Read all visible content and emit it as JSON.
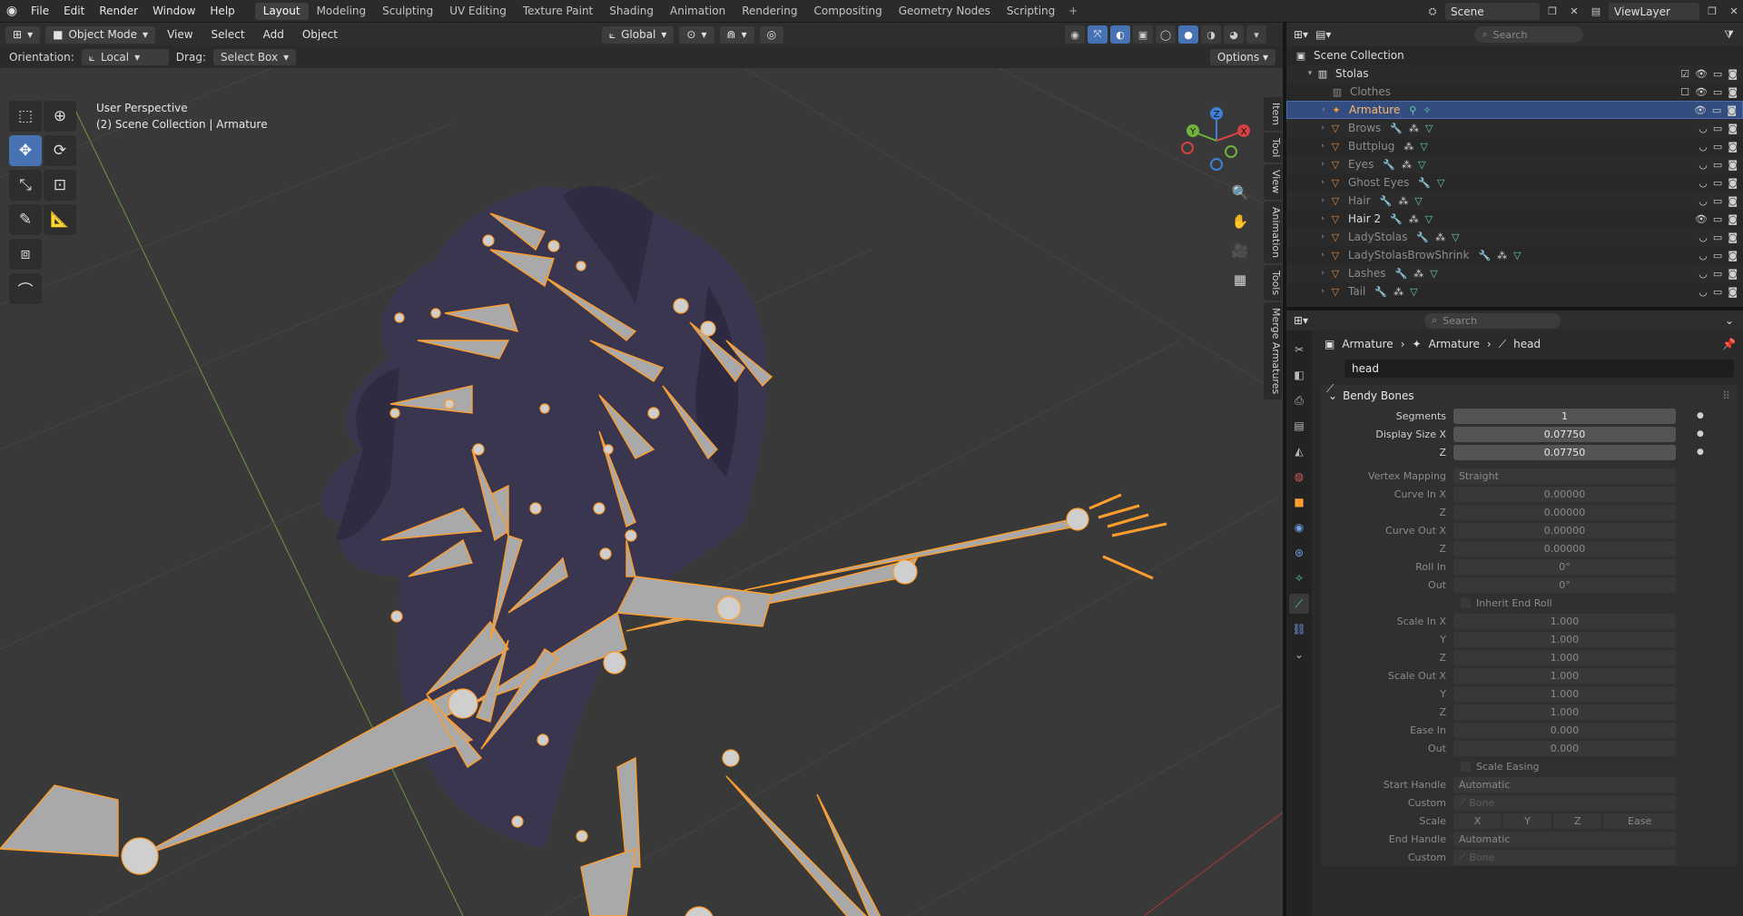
{
  "topbar": {
    "menu": [
      "File",
      "Edit",
      "Render",
      "Window",
      "Help"
    ],
    "workspaces": [
      "Layout",
      "Modeling",
      "Sculpting",
      "UV Editing",
      "Texture Paint",
      "Shading",
      "Animation",
      "Rendering",
      "Compositing",
      "Geometry Nodes",
      "Scripting"
    ],
    "active_workspace": "Layout",
    "scene_name": "Scene",
    "view_layer": "ViewLayer"
  },
  "viewport": {
    "mode": "Object Mode",
    "menu": [
      "View",
      "Select",
      "Add",
      "Object"
    ],
    "transform_orientation": "Global",
    "orientation_label": "Orientation:",
    "orientation_value": "Local",
    "drag_label": "Drag:",
    "drag_value": "Select Box",
    "options_label": "Options",
    "perspective": "User Perspective",
    "collection_info": "(2) Scene Collection | Armature",
    "side_tabs": [
      "Item",
      "Tool",
      "View",
      "Animation",
      "Tools",
      "Merge Armatures"
    ],
    "gizmo_labels": {
      "x": "X",
      "y": "Y",
      "z": "Z"
    }
  },
  "outliner": {
    "search_placeholder": "Search",
    "root": "Scene Collection",
    "collection": "Stolas",
    "items": [
      {
        "name": "Clothes",
        "dim": true
      },
      {
        "name": "Armature",
        "selected": true
      },
      {
        "name": "Brows"
      },
      {
        "name": "Buttplug"
      },
      {
        "name": "Eyes"
      },
      {
        "name": "Ghost Eyes"
      },
      {
        "name": "Hair"
      },
      {
        "name": "Hair 2",
        "bright": true
      },
      {
        "name": "LadyStolas"
      },
      {
        "name": "LadyStolasBrowShrink"
      },
      {
        "name": "Lashes"
      },
      {
        "name": "Tail"
      }
    ]
  },
  "properties": {
    "search_placeholder": "Search",
    "breadcrumb": [
      "Armature",
      "Armature",
      "head"
    ],
    "bone_name": "head",
    "panel_title": "Bendy Bones",
    "segments_label": "Segments",
    "segments": "1",
    "display_size_x_label": "Display Size X",
    "display_size_x": "0.07750",
    "z_label": "Z",
    "display_size_z": "0.07750",
    "vertex_mapping_label": "Vertex Mapping",
    "vertex_mapping": "Straight",
    "curve_in_x_label": "Curve In X",
    "curve_in_x": "0.00000",
    "curve_in_z": "0.00000",
    "curve_out_x_label": "Curve Out X",
    "curve_out_x": "0.00000",
    "curve_out_z": "0.00000",
    "roll_in_label": "Roll In",
    "roll_in": "0°",
    "out_label": "Out",
    "roll_out": "0°",
    "inherit_end_roll": "Inherit End Roll",
    "scale_in_x_label": "Scale In X",
    "scale_in_x": "1.000",
    "y_label": "Y",
    "scale_in_y": "1.000",
    "scale_in_z": "1.000",
    "scale_out_x_label": "Scale Out X",
    "scale_out_x": "1.000",
    "scale_out_y": "1.000",
    "scale_out_z": "1.000",
    "ease_in_label": "Ease In",
    "ease_in": "0.000",
    "ease_out": "0.000",
    "scale_easing": "Scale Easing",
    "start_handle_label": "Start Handle",
    "start_handle": "Automatic",
    "custom_label": "Custom",
    "custom_placeholder": "Bone",
    "scale_label": "Scale",
    "scale_x": "X",
    "scale_y": "Y",
    "scale_z": "Z",
    "scale_ease": "Ease",
    "end_handle_label": "End Handle",
    "end_handle": "Automatic"
  },
  "colors": {
    "accent": "#4772b3",
    "selection": "#ffa033",
    "bone": "#a8a8a8",
    "hair": "#3c3850"
  }
}
